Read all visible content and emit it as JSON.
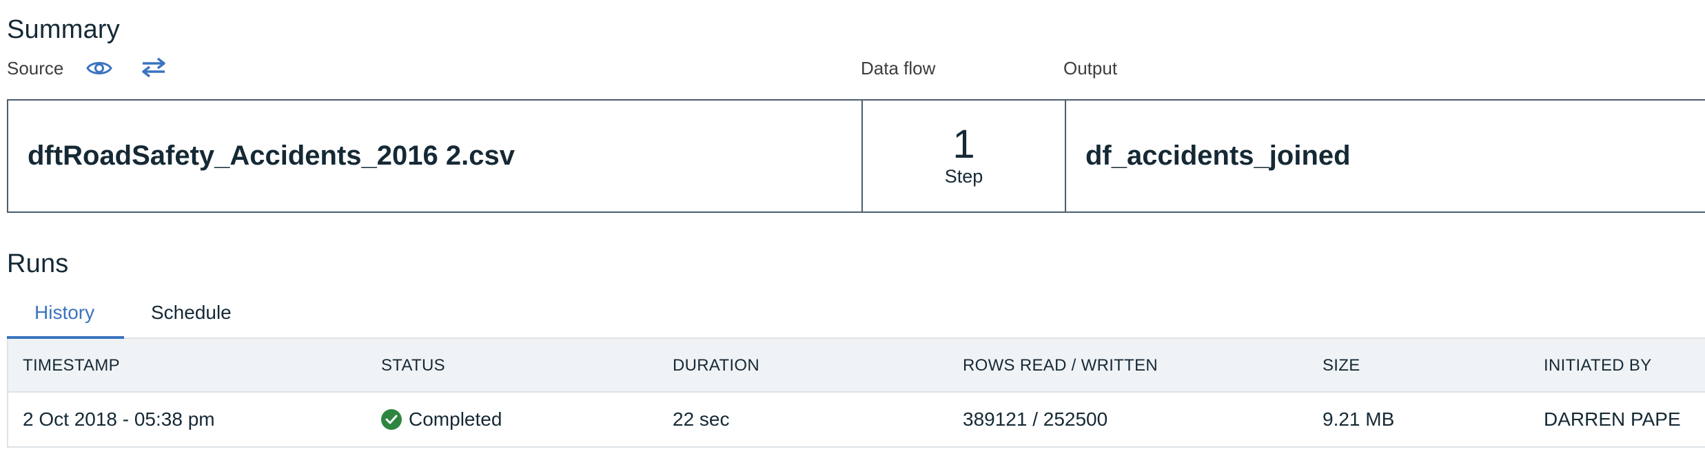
{
  "summary": {
    "title": "Summary",
    "source_label": "Source",
    "data_flow_label": "Data flow",
    "output_label": "Output",
    "source_name": "dftRoadSafety_Accidents_2016 2.csv",
    "steps_count": "1",
    "steps_label": "Step",
    "output_name": "df_accidents_joined",
    "icons": [
      "eye-icon",
      "swap-arrows-icon"
    ]
  },
  "runs": {
    "title": "Runs",
    "tabs": [
      {
        "label": "History",
        "active": true
      },
      {
        "label": "Schedule",
        "active": false
      }
    ],
    "columns": [
      "TIMESTAMP",
      "STATUS",
      "DURATION",
      "ROWS READ / WRITTEN",
      "SIZE",
      "INITIATED BY"
    ],
    "rows": [
      {
        "timestamp": "2 Oct 2018 - 05:38 pm",
        "status": "Completed",
        "status_icon": "checkmark-circle-icon",
        "duration": "22 sec",
        "rows": "389121 / 252500",
        "size": "9.21 MB",
        "initiated_by": "DARREN PAPE"
      }
    ]
  },
  "colors": {
    "accent": "#3b73c0",
    "success": "#2e8540",
    "text": "#152935",
    "header_bg": "#f0f3f6"
  }
}
